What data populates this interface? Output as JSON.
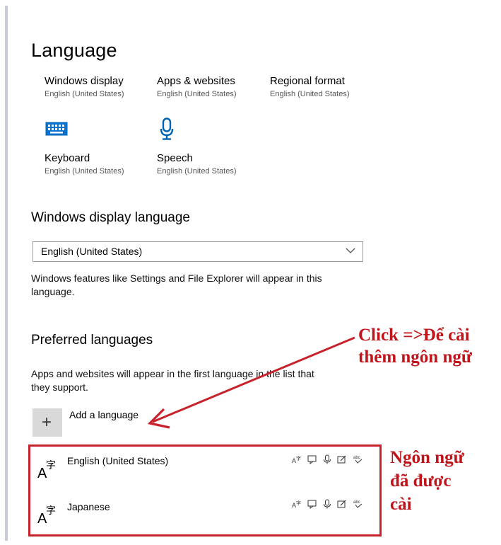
{
  "page": {
    "title": "Language"
  },
  "tiles": [
    {
      "label": "Windows display",
      "sub": "English (United States)"
    },
    {
      "label": "Apps & websites",
      "sub": "English (United States)"
    },
    {
      "label": "Regional format",
      "sub": "English (United States)"
    },
    {
      "label": "Keyboard",
      "sub": "English (United States)",
      "icon": "keyboard-icon"
    },
    {
      "label": "Speech",
      "sub": "English (United States)",
      "icon": "microphone-icon"
    }
  ],
  "display_language": {
    "heading": "Windows display language",
    "selected": "English (United States)",
    "description_line1": "Windows features like Settings and File Explorer will appear in this",
    "description_line2": "language."
  },
  "preferred": {
    "heading": "Preferred languages",
    "description_line1": "Apps and websites will appear in the first language in the list that",
    "description_line2": "they support.",
    "add_label": "Add a language",
    "add_glyph": "+",
    "languages": [
      {
        "name": "English (United States)",
        "icon": "language-icon"
      },
      {
        "name": "Japanese",
        "icon": "language-icon"
      }
    ]
  },
  "annotations": {
    "click_line1": "Click =>Để cài",
    "click_line2": "thêm ngôn ngữ",
    "installed_line1": "Ngôn ngữ",
    "installed_line2": "đã được",
    "installed_line3": "cài",
    "color": "#c0141b"
  },
  "colors": {
    "accent": "#0063b1",
    "frame": "#c8232c"
  }
}
